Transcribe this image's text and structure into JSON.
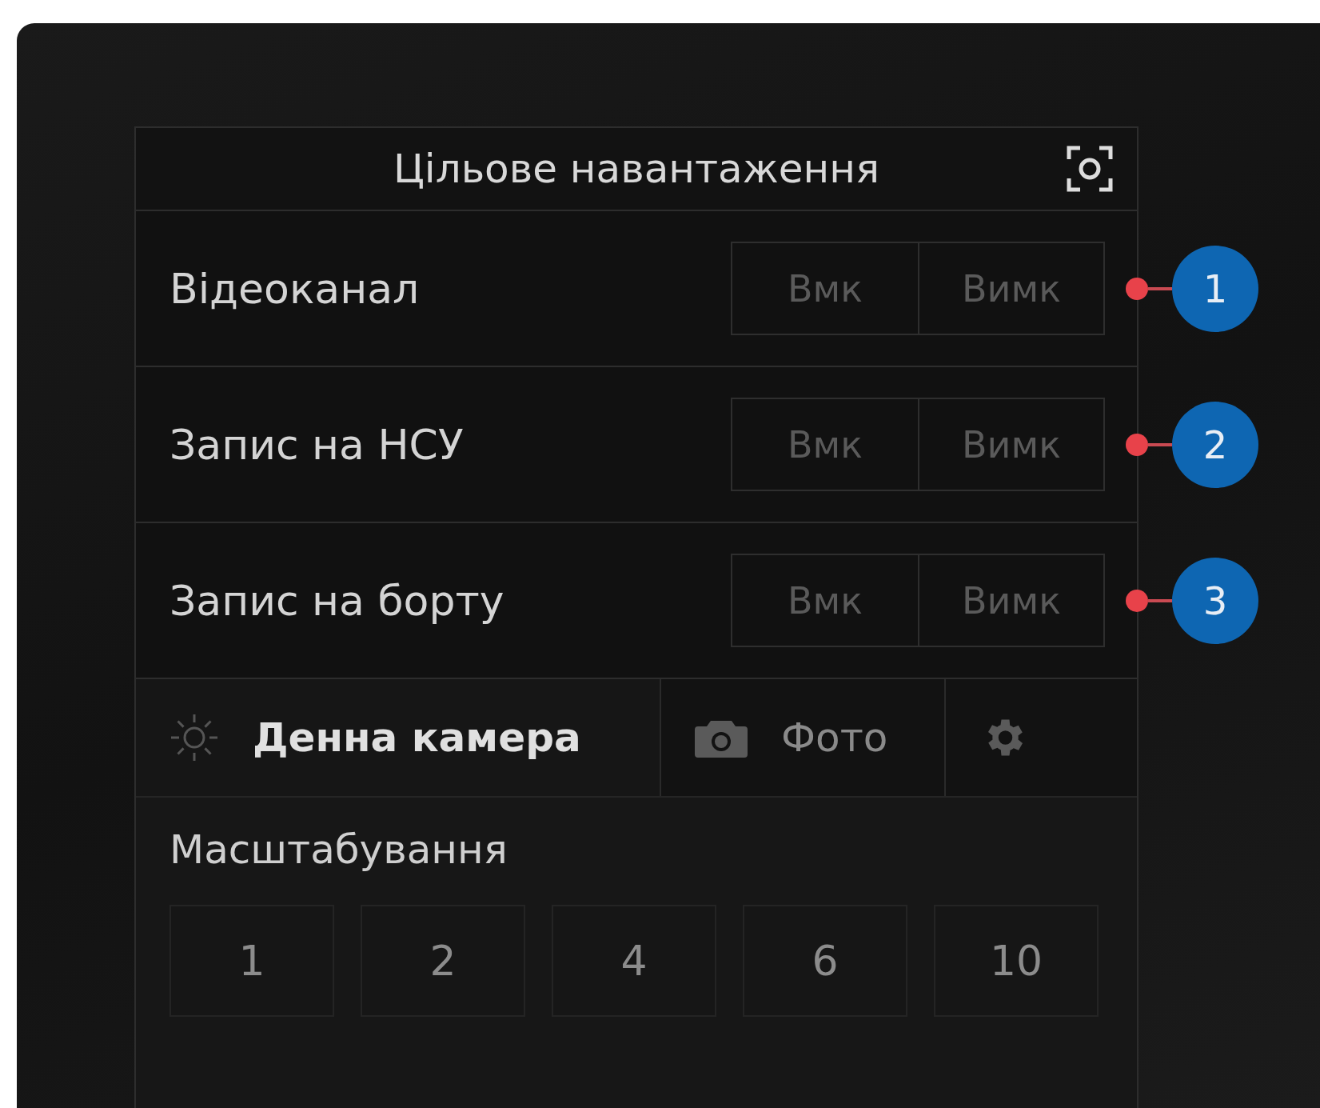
{
  "panel": {
    "title": "Цільове навантаження"
  },
  "toggles": [
    {
      "label": "Відеоканал",
      "options": [
        {
          "label": "Вмк",
          "selected": false
        },
        {
          "label": "Вимк",
          "selected": false
        }
      ],
      "callout": "1"
    },
    {
      "label": "Запис на НСУ",
      "options": [
        {
          "label": "Вмк",
          "selected": false
        },
        {
          "label": "Вимк",
          "selected": false
        }
      ],
      "callout": "2"
    },
    {
      "label": "Запис на борту",
      "options": [
        {
          "label": "Вмк",
          "selected": false
        },
        {
          "label": "Вимк",
          "selected": false
        }
      ],
      "callout": "3"
    }
  ],
  "camera": {
    "title": "Денна камера",
    "photo_button": "Фото"
  },
  "zoom": {
    "label": "Масштабування",
    "levels": [
      {
        "label": "1",
        "selected": false
      },
      {
        "label": "2",
        "selected": false
      },
      {
        "label": "4",
        "selected": false
      },
      {
        "label": "6",
        "selected": false
      },
      {
        "label": "10",
        "selected": false
      }
    ]
  }
}
